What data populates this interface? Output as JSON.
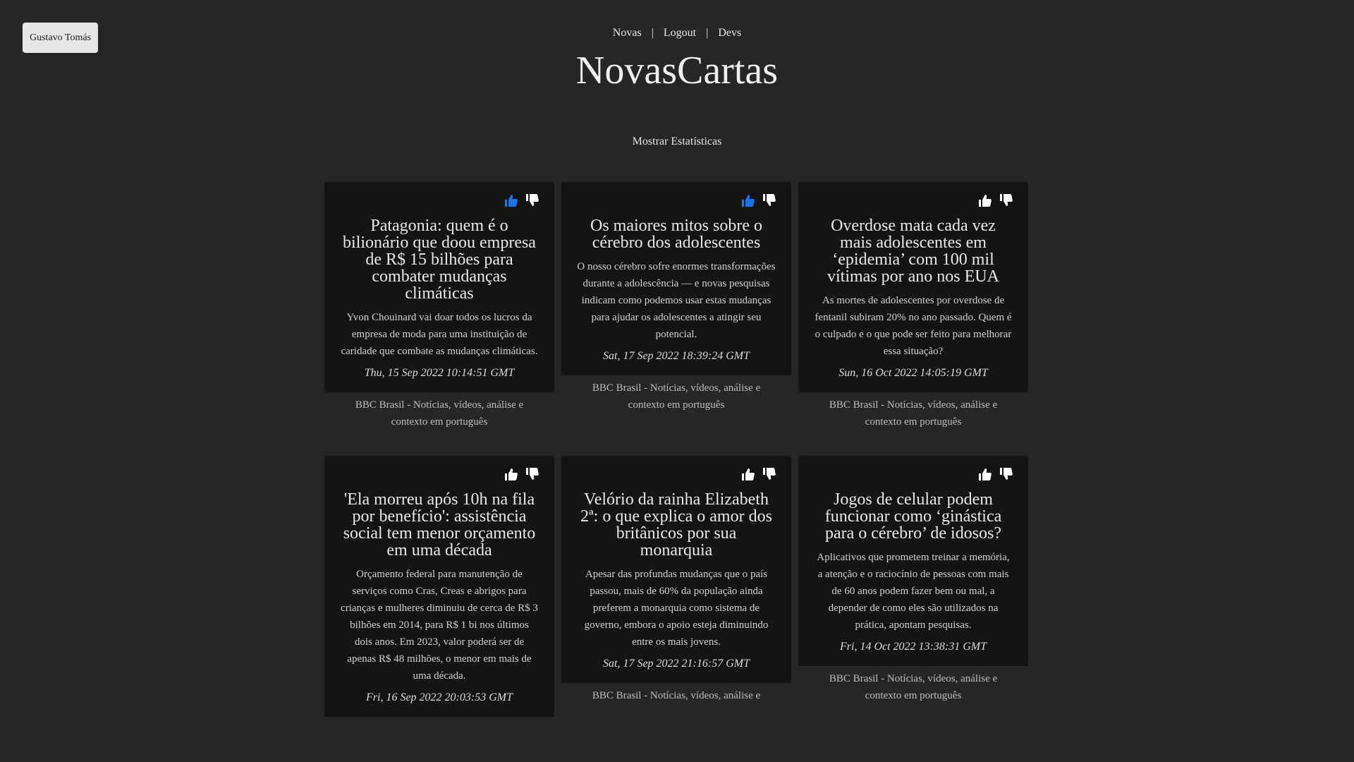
{
  "user": {
    "name": "Gustavo Tomás"
  },
  "nav": {
    "items": [
      "Novas",
      "Logout",
      "Devs"
    ],
    "separator": "|"
  },
  "site": {
    "title": "NovasCartas"
  },
  "stats_link": "Mostrar Estatísticas",
  "colors": {
    "background": "#262626",
    "card": "#141414",
    "like_active": "#1a73e8",
    "icon": "#ffffff"
  },
  "articles": [
    {
      "title": "Patagonia: quem é o bilionário que doou empresa de R$ 15 bilhões para combater mudanças climáticas",
      "summary": "Yvon Chouinard vai doar todos os lucros da empresa de moda para uma instituição de caridade que combate as mudanças climáticas.",
      "date": "Thu, 15 Sep 2022 10:14:51 GMT",
      "source": "BBC Brasil - Notícias, vídeos, análise e contexto em português",
      "liked": true
    },
    {
      "title": "Os maiores mitos sobre o cérebro dos adolescentes",
      "summary": "O nosso cérebro sofre enormes transformações durante a adolescência — e novas pesquisas indicam como podemos usar estas mudanças para ajudar os adolescentes a atingir seu potencial.",
      "date": "Sat, 17 Sep 2022 18:39:24 GMT",
      "source": "BBC Brasil - Notícias, vídeos, análise e contexto em português",
      "liked": true
    },
    {
      "title": "Overdose mata cada vez mais adolescentes em ‘epidemia’ com 100 mil vítimas por ano nos EUA",
      "summary": "As mortes de adolescentes por overdose de fentanil subiram 20% no ano passado. Quem é o culpado e o que pode ser feito para melhorar essa situação?",
      "date": "Sun, 16 Oct 2022 14:05:19 GMT",
      "source": "BBC Brasil - Notícias, vídeos, análise e contexto em português",
      "liked": false
    },
    {
      "title": "'Ela morreu após 10h na fila por benefício': assistência social tem menor orçamento em uma década",
      "summary": "Orçamento federal para manutenção de serviços como Cras, Creas e abrigos para crianças e mulheres diminuiu de cerca de R$ 3 bilhões em 2014, para R$ 1 bi nos últimos dois anos. Em 2023, valor poderá ser de apenas R$ 48 milhões, o menor em mais de uma década.",
      "date": "Fri, 16 Sep 2022 20:03:53 GMT",
      "source": "",
      "liked": false
    },
    {
      "title": "Velório da rainha Elizabeth 2ª: o que explica o amor dos britânicos por sua monarquia",
      "summary": "Apesar das profundas mudanças que o país passou, mais de 60% da população ainda preferem a monarquia como sistema de governo, embora o apoio esteja diminuindo entre os mais jovens.",
      "date": "Sat, 17 Sep 2022 21:16:57 GMT",
      "source": "BBC Brasil - Notícias, vídeos, análise e",
      "liked": false
    },
    {
      "title": "Jogos de celular podem funcionar como ‘ginástica para o cérebro’ de idosos?",
      "summary": "Aplicativos que prometem treinar a memória, a atenção e o raciocínio de pessoas com mais de 60 anos podem fazer bem ou mal, a depender de como eles são utilizados na prática, apontam pesquisas.",
      "date": "Fri, 14 Oct 2022 13:38:31 GMT",
      "source": "BBC Brasil - Notícias, vídeos, análise e contexto em português",
      "liked": false
    }
  ]
}
